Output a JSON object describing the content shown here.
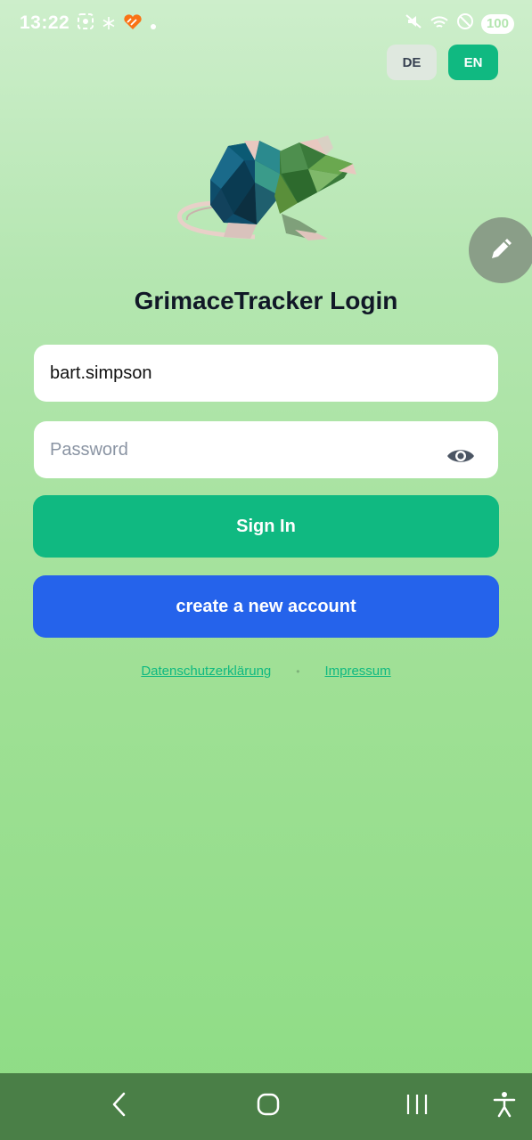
{
  "status_bar": {
    "time": "13:22",
    "battery": "100",
    "left_icons": [
      "screenshot-icon",
      "snowflake-icon",
      "app-heart-icon",
      "dot-icon"
    ],
    "right_icons": [
      "mute-icon",
      "wifi-icon",
      "do-not-disturb-icon"
    ]
  },
  "language": {
    "de_label": "DE",
    "en_label": "EN",
    "selected": "EN"
  },
  "title": "GrimaceTracker Login",
  "username": {
    "value": "bart.simpson"
  },
  "password": {
    "placeholder": "Password"
  },
  "buttons": {
    "sign_in": "Sign In",
    "create_account": "create a new account"
  },
  "links": {
    "privacy": "Datenschutzerklärung",
    "separator": "•",
    "imprint": "Impressum"
  },
  "colors": {
    "primary_green": "#10b981",
    "primary_blue": "#2563eb",
    "nav_bar": "#4a7f47"
  }
}
